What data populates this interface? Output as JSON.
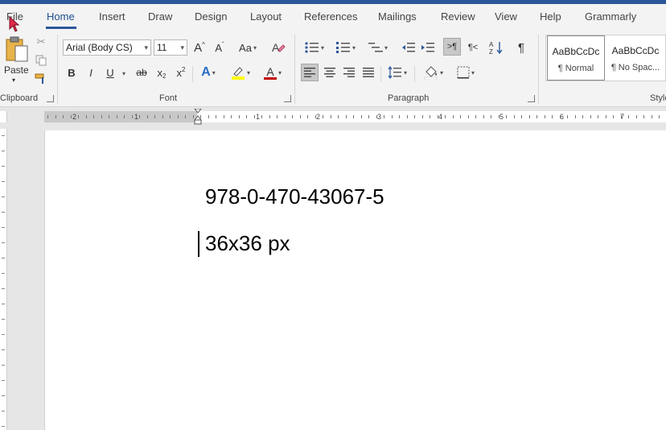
{
  "menu": {
    "tabs": [
      {
        "label": "File"
      },
      {
        "label": "Home"
      },
      {
        "label": "Insert"
      },
      {
        "label": "Draw"
      },
      {
        "label": "Design"
      },
      {
        "label": "Layout"
      },
      {
        "label": "References"
      },
      {
        "label": "Mailings"
      },
      {
        "label": "Review"
      },
      {
        "label": "View"
      },
      {
        "label": "Help"
      },
      {
        "label": "Grammarly"
      }
    ],
    "active_tab": "Home"
  },
  "clipboard": {
    "paste_label": "Paste",
    "group_label": "Clipboard"
  },
  "font": {
    "name": "Arial (Body CS)",
    "size": "11",
    "case_label": "Aa",
    "group_label": "Font",
    "bold": "B",
    "italic": "I",
    "underline": "U",
    "strike": "ab",
    "subscript": "x",
    "superscript": "x",
    "grow": "A",
    "shrink": "A",
    "effects": "A",
    "color_letter": "A",
    "highlight_color": "#ffff00",
    "font_color": "#c00000"
  },
  "paragraph": {
    "group_label": "Paragraph",
    "pilcrow": "¶"
  },
  "styles": {
    "items": [
      {
        "preview": "AaBbCcDc",
        "name": "¶ Normal"
      },
      {
        "preview": "AaBbCcDc",
        "name": "¶ No Spac..."
      }
    ],
    "group_label": "Styles"
  },
  "ruler": {
    "labels": [
      "2",
      "1",
      "1",
      "2",
      "3",
      "4",
      "5",
      "6",
      "7"
    ]
  },
  "document": {
    "lines": [
      "978-0-470-43067-5",
      "36x36 px"
    ]
  },
  "colors": {
    "accent": "#2b579a",
    "ribbon": "#f3f3f3"
  }
}
